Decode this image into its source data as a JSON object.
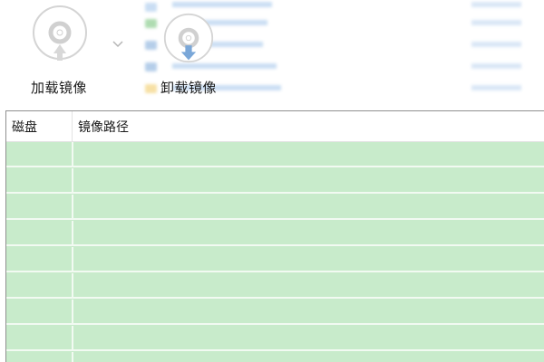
{
  "toolbar": {
    "mount_image": {
      "label": "加载镜像",
      "icon": "disc-mount-icon"
    },
    "unmount_image": {
      "label": "卸载镜像",
      "icon": "disc-unmount-icon"
    },
    "dropdown_icon": "chevron-down-icon"
  },
  "table": {
    "columns": [
      {
        "key": "disk",
        "label": "磁盘"
      },
      {
        "key": "image_path",
        "label": "镜像路径"
      }
    ],
    "rows": [
      {
        "disk": "",
        "image_path": ""
      },
      {
        "disk": "",
        "image_path": ""
      },
      {
        "disk": "",
        "image_path": ""
      },
      {
        "disk": "",
        "image_path": ""
      },
      {
        "disk": "",
        "image_path": ""
      },
      {
        "disk": "",
        "image_path": ""
      },
      {
        "disk": "",
        "image_path": ""
      },
      {
        "disk": "",
        "image_path": ""
      },
      {
        "disk": "",
        "image_path": ""
      }
    ]
  },
  "colors": {
    "row_fill": "#c8ebcb",
    "row_separator": "#f2faf2",
    "disc_gray": "#d4d4d4",
    "arrow_blue": "#7aa7d8"
  }
}
